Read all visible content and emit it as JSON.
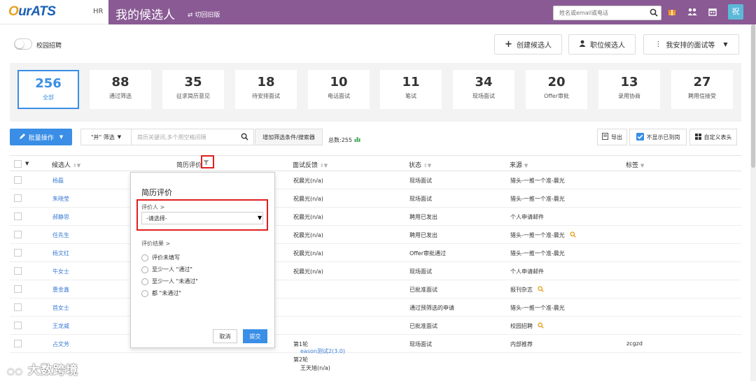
{
  "logo": {
    "text": "OurATS"
  },
  "header": {
    "hr_label": "HR",
    "title": "我的候选人",
    "switch_old": "切回旧版",
    "search_placeholder": "姓名或email或电话",
    "avatar": "祝",
    "icons": [
      "gift-icon",
      "group-icon",
      "calendar-icon"
    ]
  },
  "campus": {
    "label": "校园招聘",
    "on": false
  },
  "actions": {
    "create": "创建候选人",
    "job": "职位候选人",
    "interviews": "我安排的面试等"
  },
  "stats": [
    {
      "num": "256",
      "label": "全部",
      "active": true
    },
    {
      "num": "88",
      "label": "通过筛选"
    },
    {
      "num": "35",
      "label": "征求简历意见"
    },
    {
      "num": "18",
      "label": "待安排面试"
    },
    {
      "num": "10",
      "label": "电话面试"
    },
    {
      "num": "11",
      "label": "笔试"
    },
    {
      "num": "34",
      "label": "现场面试"
    },
    {
      "num": "20",
      "label": "Offer审批"
    },
    {
      "num": "13",
      "label": "录用协商"
    },
    {
      "num": "27",
      "label": "聘用信接受"
    }
  ],
  "toolbar": {
    "bulk": "批量操作",
    "filter_mode": "\"并\" 筛选",
    "search_placeholder": "简历关键词,多个用空格间隔",
    "add_filter": "增加筛选条件/搜索器",
    "total": "总数:255",
    "export": "导出",
    "hide_onboard": "不显示已到岗",
    "custom_cols": "自定义表头"
  },
  "columns": {
    "candidate": "候选人",
    "resume_review": "简历评价",
    "interview_fb": "面试反馈",
    "status": "状态",
    "source": "来源",
    "tags": "标签"
  },
  "rows": [
    {
      "name": "杨磊",
      "feedback": "祝晨光(n/a)",
      "status": "现场面试",
      "source": "猎头-一推一个准-晨光",
      "mag": false,
      "tag": ""
    },
    {
      "name": "朱晓莹",
      "feedback": "祝晨光(n/a)",
      "status": "现场面试",
      "source": "猎头-一推一个准-晨光",
      "mag": false,
      "tag": ""
    },
    {
      "name": "郝静思",
      "feedback": "祝晨光(n/a)",
      "status": "聘用已发出",
      "source": "个人申请邮件",
      "mag": false,
      "tag": ""
    },
    {
      "name": "任先生",
      "feedback": "祝晨光(n/a)",
      "status": "聘用已发出",
      "source": "猎头-一推一个准-晨光",
      "mag": true,
      "tag": ""
    },
    {
      "name": "杨文红",
      "feedback": "祝晨光(n/a)",
      "status": "Offer审批通过",
      "source": "猎头-一推一个准-晨光",
      "mag": false,
      "tag": ""
    },
    {
      "name": "牛女士",
      "feedback": "祝晨光(n/a)",
      "status": "现场面试",
      "source": "个人申请邮件",
      "mag": false,
      "tag": ""
    },
    {
      "name": "惠金鑫",
      "feedback": "",
      "status": "已批准面试",
      "source": "报刊杂志",
      "mag": true,
      "tag": ""
    },
    {
      "name": "首女士",
      "feedback": "",
      "status": "通过预筛选的申请",
      "source": "猎头-一推一个准-晨光",
      "mag": false,
      "tag": ""
    },
    {
      "name": "王龙威",
      "feedback": "",
      "status": "已批准面试",
      "source": "校园招聘",
      "mag": true,
      "tag": ""
    },
    {
      "name": "占文芳",
      "feedback": "第1轮",
      "status": "现场面试",
      "source": "内部推荐",
      "mag": false,
      "tag": "zcgzd"
    }
  ],
  "row10_extra": {
    "r1_detail": "eason测试2(3.0)",
    "r2": "第2轮",
    "r2_detail": "王天旭(n/a)"
  },
  "popup": {
    "title": "简历评价",
    "reviewer_label": "评价人 >",
    "select_placeholder": "-请选择-",
    "result_label": "评价结果 >",
    "options": [
      "评价未填写",
      "至少一人 \"通过\"",
      "至少一人 \"未通过\"",
      "都 \"未通过\""
    ],
    "cancel": "取消",
    "submit": "提交"
  },
  "watermark": "大数跨境",
  "colors": {
    "header_bg": "#8a5a94",
    "accent": "#3a8ee6",
    "highlight": "#e02020"
  }
}
